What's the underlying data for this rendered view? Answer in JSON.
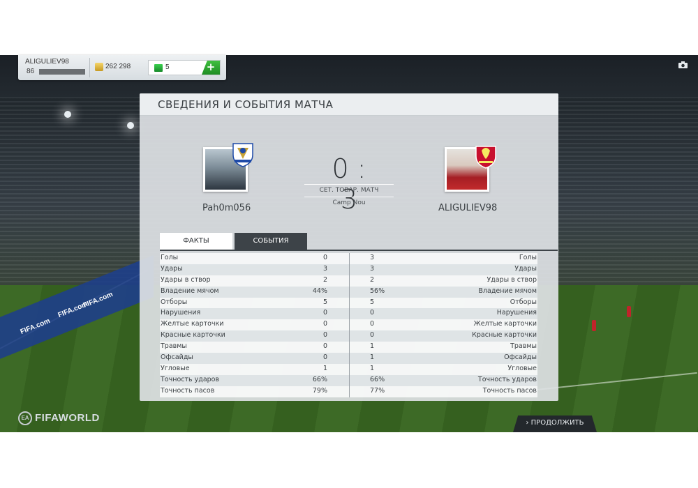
{
  "topbar": {
    "username": "ALIGULIEV98",
    "level": "86",
    "xp_progress": 0.0,
    "coins": "262 298",
    "points": "5",
    "add_label": "+"
  },
  "panel": {
    "title": "СВЕДЕНИЯ И СОБЫТИЯ МАТЧА",
    "home_team": "Pah0m056",
    "away_team": "ALIGULIEV98",
    "score": "0 : 3",
    "match_type": "СЕТ. ТОВАР. МАТЧ",
    "stadium": "Camp Nou",
    "tabs": [
      {
        "label": "ФАКТЫ",
        "active": true
      },
      {
        "label": "СОБЫТИЯ",
        "active": false
      }
    ]
  },
  "stats": [
    {
      "label": "Голы",
      "home": "0",
      "away": "3"
    },
    {
      "label": "Удары",
      "home": "3",
      "away": "3"
    },
    {
      "label": "Удары в створ",
      "home": "2",
      "away": "2"
    },
    {
      "label": "Владение мячом",
      "home": "44%",
      "away": "56%"
    },
    {
      "label": "Отборы",
      "home": "5",
      "away": "5"
    },
    {
      "label": "Нарушения",
      "home": "0",
      "away": "0"
    },
    {
      "label": "Желтые карточки",
      "home": "0",
      "away": "0"
    },
    {
      "label": "Красные карточки",
      "home": "0",
      "away": "0"
    },
    {
      "label": "Травмы",
      "home": "0",
      "away": "1"
    },
    {
      "label": "Офсайды",
      "home": "0",
      "away": "1"
    },
    {
      "label": "Угловые",
      "home": "1",
      "away": "1"
    },
    {
      "label": "Точность ударов",
      "home": "66%",
      "away": "66%"
    },
    {
      "label": "Точность пасов",
      "home": "79%",
      "away": "77%"
    }
  ],
  "footer": {
    "logo_text": "FIFAWORLD",
    "ea_text": "EA",
    "continue_label": "ПРОДОЛЖИТЬ",
    "continue_chevron": "›"
  },
  "background": {
    "ad_texts": [
      "FIFA.com",
      "FIFA.com",
      "FIFA.com"
    ]
  }
}
